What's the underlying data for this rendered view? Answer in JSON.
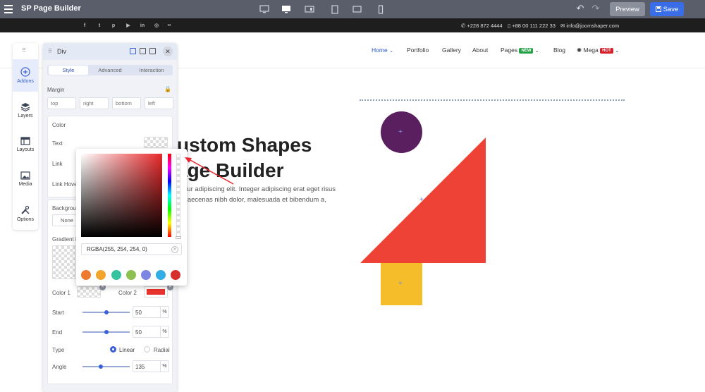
{
  "topbar": {
    "app_title": "SP Page Builder",
    "preview_label": "Preview",
    "save_label": "Save"
  },
  "social": {
    "icons": [
      "facebook-icon",
      "twitter-icon",
      "pinterest-icon",
      "youtube-icon",
      "linkedin-icon",
      "instagram-icon",
      "flickr-icon"
    ],
    "phone1": "+228 872 4444",
    "phone2": "+88 00 111 222 33",
    "email": "info@joomshaper.com"
  },
  "nav": {
    "home": "Home",
    "portfolio": "Portfolio",
    "gallery": "Gallery",
    "about": "About",
    "pages": "Pages",
    "pages_badge": "NEW",
    "blog": "Blog",
    "mega": "Mega",
    "mega_badge": "HOT"
  },
  "hero": {
    "line1": "ustom Shapes",
    "line2": "age Builder",
    "para1": "ctetur adipiscing elit. Integer adipiscing erat eget risus",
    "para2": "t. Maecenas nibh dolor, malesuada et bibendum a,"
  },
  "sidebar": {
    "items": [
      {
        "label": "Addons"
      },
      {
        "label": "Layers"
      },
      {
        "label": "Layouts"
      },
      {
        "label": "Media"
      },
      {
        "label": "Options"
      }
    ]
  },
  "panel": {
    "title": "Div",
    "tabs": [
      "Style",
      "Advanced",
      "Interaction"
    ],
    "margin_label": "Margin",
    "margin_placeholders": {
      "top": "top",
      "right": "right",
      "bottom": "bottom",
      "left": "left"
    },
    "color_label": "Color",
    "text_label": "Text",
    "link_label": "Link",
    "link_hover_label": "Link Hove",
    "background_label": "Backgrou",
    "none_label": "None",
    "gradient_label": "Gradient B",
    "color1_label": "Color 1",
    "color2_label": "Color 2",
    "start_label": "Start",
    "start_value": "50",
    "end_label": "End",
    "end_value": "50",
    "type_label": "Type",
    "linear_label": "Linear",
    "radial_label": "Radial",
    "angle_label": "Angle",
    "angle_value": "135",
    "unit": "%"
  },
  "picker": {
    "value": "RGBA(255, 254, 254, 0)",
    "swatches": [
      "#ee7a2f",
      "#f3a52b",
      "#36c3a0",
      "#8cc152",
      "#7a86e0",
      "#31aee6",
      "#d6302e"
    ]
  },
  "colors": {
    "accent": "#3a6ee8",
    "circle": "#5a1f5e",
    "triangle": "#ee4237",
    "square": "#f6bd2a"
  }
}
